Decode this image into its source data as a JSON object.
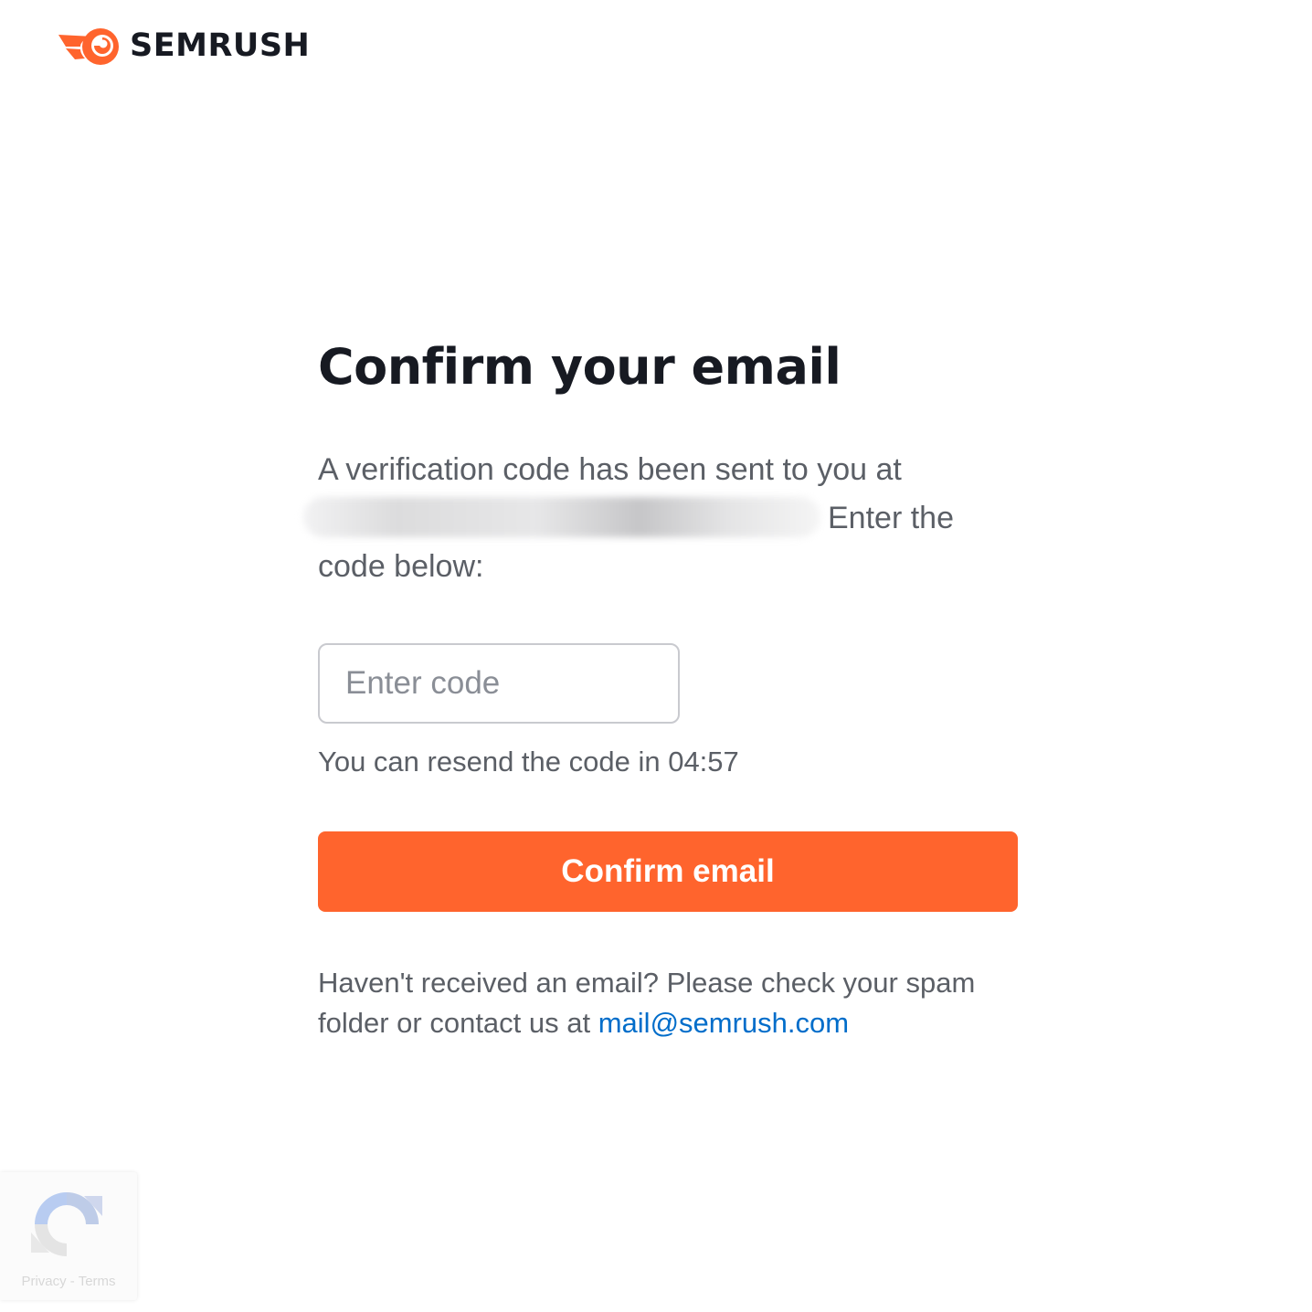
{
  "brand": {
    "name": "SEMRUSH",
    "accent_color": "#ff642d",
    "logo_icon": "semrush-fireball-icon"
  },
  "main": {
    "title": "Confirm your email",
    "description_before": "A verification code has been sent to you at",
    "description_after": "Enter the code below:",
    "code_placeholder": "Enter code",
    "code_value": "",
    "resend_text": "You can resend the code in 04:57",
    "confirm_label": "Confirm email",
    "help_text": "Haven't received an email? Please check your spam folder or contact us at",
    "help_email": "mail@semrush.com",
    "link_color": "#006dca"
  },
  "recaptcha": {
    "icon": "recaptcha-icon",
    "privacy_label": "Privacy",
    "separator": "-",
    "terms_label": "Terms"
  }
}
